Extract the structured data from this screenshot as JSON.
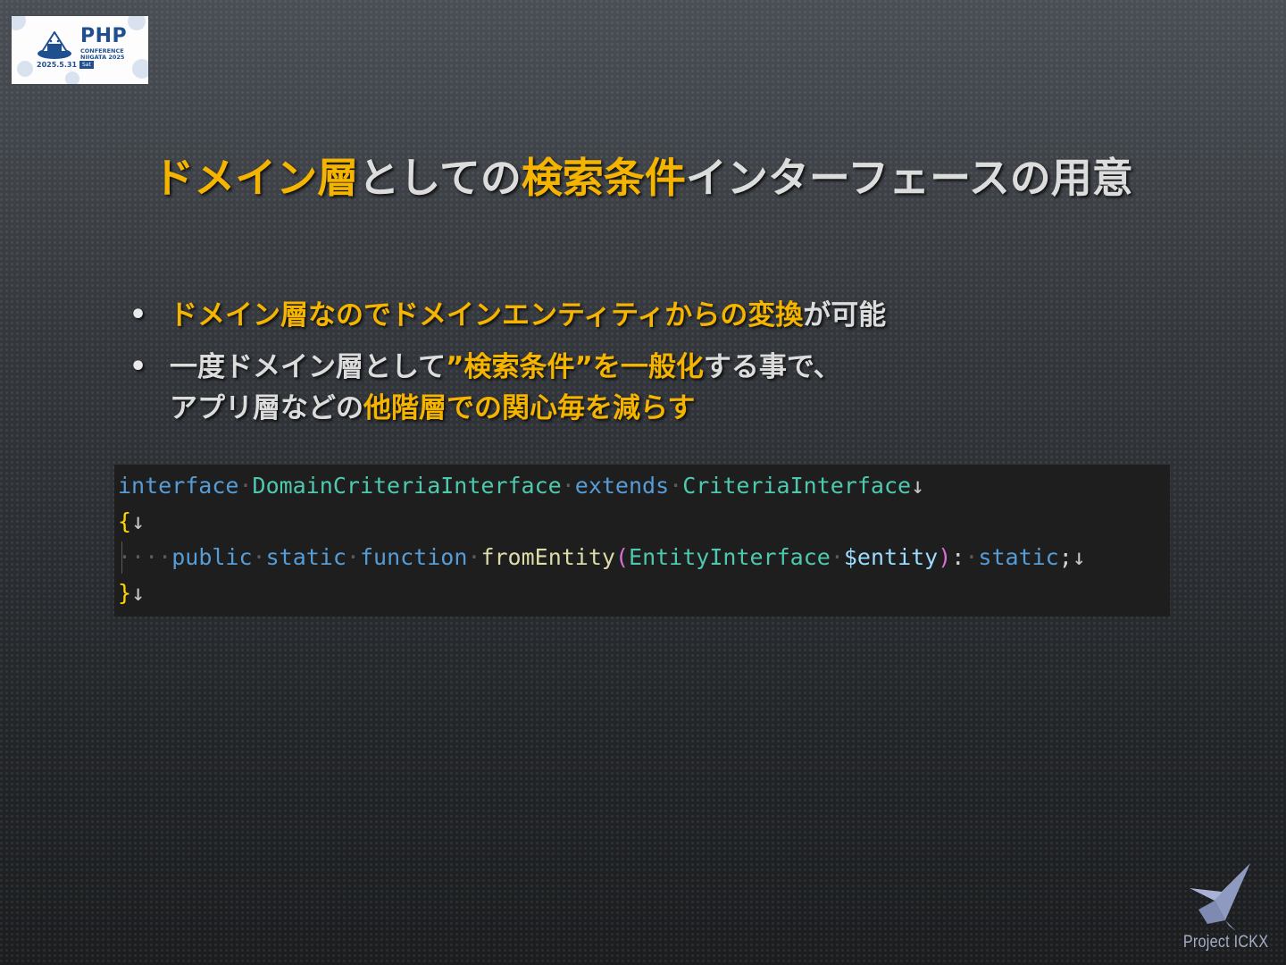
{
  "logo": {
    "name": "PHP",
    "sub": "CONFERENCE NIIGATA 2025",
    "date": "2025.5.31",
    "day": "Sat"
  },
  "title": {
    "parts": [
      {
        "text": "ドメイン層",
        "hl": true
      },
      {
        "text": "としての",
        "hl": false
      },
      {
        "text": "検索条件",
        "hl": true
      },
      {
        "text": "インターフェースの用意",
        "hl": false
      }
    ]
  },
  "bullets": [
    {
      "lines": [
        [
          {
            "text": "ドメイン層なのでドメインエンティティからの変換",
            "hl": true
          },
          {
            "text": "が可能",
            "hl": false
          }
        ]
      ]
    },
    {
      "lines": [
        [
          {
            "text": "一度ドメイン層として",
            "hl": false
          },
          {
            "text": "”検索条件”を一般化",
            "hl": true
          },
          {
            "text": "する事で、",
            "hl": false
          }
        ],
        [
          {
            "text": "アプリ層などの",
            "hl": false
          },
          {
            "text": "他階層での関心毎を減らす",
            "hl": true
          }
        ]
      ]
    }
  ],
  "code": {
    "lines": [
      [
        {
          "c": "k",
          "t": "interface"
        },
        {
          "c": "ws",
          "t": "·"
        },
        {
          "c": "t",
          "t": "DomainCriteriaInterface"
        },
        {
          "c": "ws",
          "t": "·"
        },
        {
          "c": "k",
          "t": "extends"
        },
        {
          "c": "ws",
          "t": "·"
        },
        {
          "c": "t",
          "t": "CriteriaInterface"
        },
        {
          "c": "nl",
          "t": "↓"
        }
      ],
      [
        {
          "c": "b1",
          "t": "{"
        },
        {
          "c": "nl",
          "t": "↓"
        }
      ],
      [
        {
          "c": "ws",
          "t": "····"
        },
        {
          "c": "k",
          "t": "public"
        },
        {
          "c": "ws",
          "t": "·"
        },
        {
          "c": "k",
          "t": "static"
        },
        {
          "c": "ws",
          "t": "·"
        },
        {
          "c": "k",
          "t": "function"
        },
        {
          "c": "ws",
          "t": "·"
        },
        {
          "c": "f",
          "t": "fromEntity"
        },
        {
          "c": "b2",
          "t": "("
        },
        {
          "c": "t",
          "t": "EntityInterface"
        },
        {
          "c": "ws",
          "t": "·"
        },
        {
          "c": "v",
          "t": "$entity"
        },
        {
          "c": "b2",
          "t": ")"
        },
        {
          "c": "p",
          "t": ":"
        },
        {
          "c": "ws",
          "t": "·"
        },
        {
          "c": "k",
          "t": "static"
        },
        {
          "c": "p",
          "t": ";"
        },
        {
          "c": "nl",
          "t": "↓"
        }
      ],
      [
        {
          "c": "b1",
          "t": "}"
        },
        {
          "c": "nl",
          "t": "↓"
        }
      ]
    ]
  },
  "brand": {
    "text": "Project ICKX"
  }
}
